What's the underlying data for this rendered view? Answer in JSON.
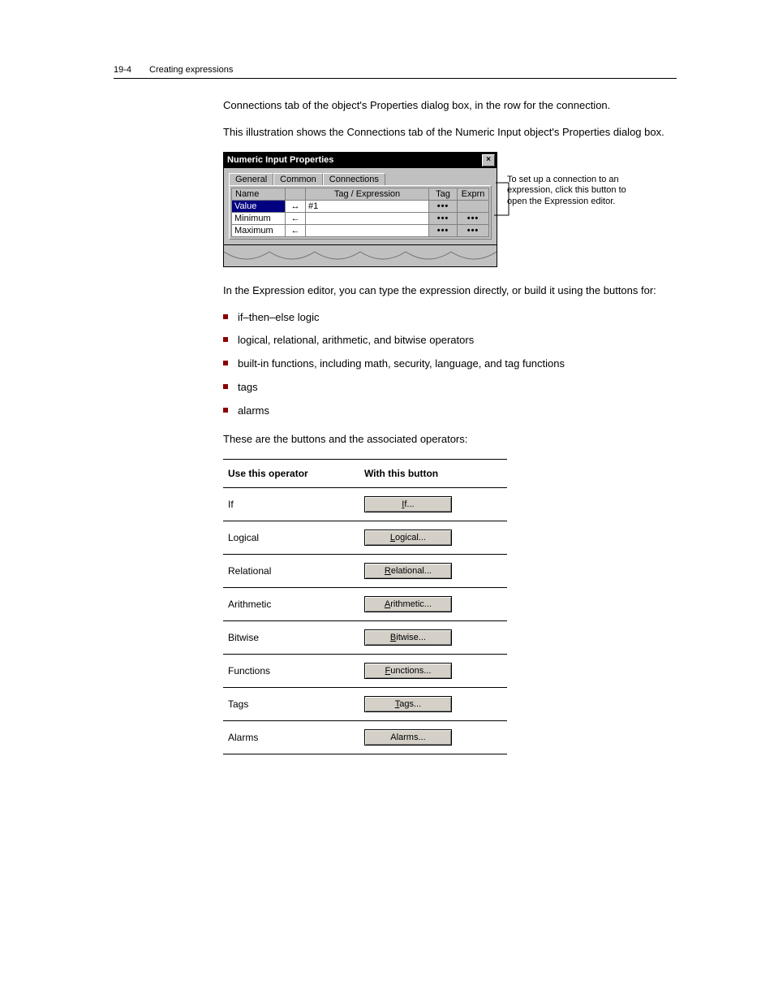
{
  "header": {
    "chapter": "19-4",
    "title": "Creating expressions"
  },
  "intro": {
    "p1": "Connections tab of the object's Properties dialog box, in the row for the connection.",
    "p2": "This illustration shows the Connections tab of the Numeric Input object's Properties dialog box."
  },
  "dialog": {
    "title": "Numeric Input Properties",
    "tabs": [
      "General",
      "Common",
      "Connections"
    ],
    "active_tab": 2,
    "columns": {
      "name": "Name",
      "expr": "Tag / Expression",
      "tag": "Tag",
      "exprn": "Exprn"
    },
    "rows": [
      {
        "name": "Value",
        "dir": "both",
        "value": "#1"
      },
      {
        "name": "Minimum",
        "dir": "left",
        "value": ""
      },
      {
        "name": "Maximum",
        "dir": "left",
        "value": ""
      }
    ],
    "callout": "To set up a connection to an expression, click this button to open the Expression editor."
  },
  "midtext": "In the Expression editor, you can type the expression directly, or build it using the buttons for:",
  "bullets": [
    "if–then–else logic",
    "logical, relational, arithmetic, and bitwise operators",
    "built-in functions, including math, security, language, and tag functions",
    "tags",
    "alarms"
  ],
  "table_note": "These are the buttons and the associated operators:",
  "optable": {
    "headers": [
      "Use this operator",
      "With this button"
    ],
    "rows": [
      {
        "op": "If",
        "btn": {
          "ul": "I",
          "rest": "f..."
        }
      },
      {
        "op": "Logical",
        "btn": {
          "ul": "L",
          "rest": "ogical..."
        }
      },
      {
        "op": "Relational",
        "btn": {
          "ul": "R",
          "rest": "elational..."
        }
      },
      {
        "op": "Arithmetic",
        "btn": {
          "ul": "A",
          "rest": "rithmetic..."
        }
      },
      {
        "op": "Bitwise",
        "btn": {
          "ul": "B",
          "rest": "itwise..."
        }
      },
      {
        "op": "Functions",
        "btn": {
          "ul": "F",
          "rest": "unctions..."
        }
      },
      {
        "op": "Tags",
        "btn": {
          "ul": "T",
          "rest": "ags..."
        }
      },
      {
        "op": "Alarms",
        "btn": {
          "ul": "",
          "rest": "Alarms..."
        }
      }
    ]
  }
}
